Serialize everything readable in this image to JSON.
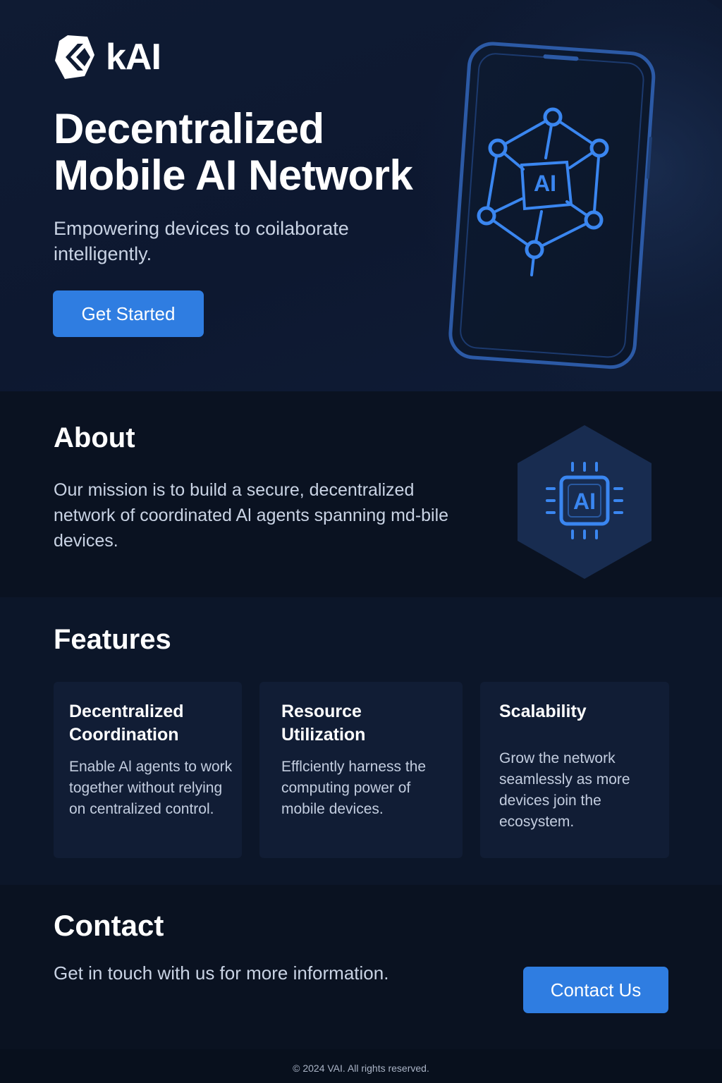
{
  "brand": {
    "name": "kAI",
    "logo_icon": "hexagon-k-logo-icon"
  },
  "hero": {
    "title_line1": "Decentralized",
    "title_line2": "Mobile AI Network",
    "subtitle": "Empowering devices to coilaborate intelligently.",
    "cta_label": "Get Started",
    "illustration_label": "AI",
    "illustration_icon": "smartphone-ai-network-icon"
  },
  "about": {
    "title": "About",
    "text": "Our mission is to build a secure, decentralized network of coordinated Al agents spanning md-bile devices.",
    "icon_label": "AI",
    "icon": "ai-chip-hexagon-icon"
  },
  "features": {
    "title": "Features",
    "cards": [
      {
        "title": "Decentralized Coordination",
        "text": "Enable Al agents to work together without relying on centralized control."
      },
      {
        "title": "Resource Utilization",
        "text": "Efflciently harness the computing power of mobile devices."
      },
      {
        "title": "Scalability",
        "text": "Grow the network seamlessly as more devices join the ecosystem."
      }
    ]
  },
  "contact": {
    "title": "Contact",
    "text": "Get in touch with us for more information.",
    "cta_label": "Contact Us"
  },
  "footer": {
    "text": "© 2024  VAI. All rights reserved."
  },
  "colors": {
    "background": "#0b1424",
    "accent": "#2f7de1",
    "icon_blue": "#3a86f0",
    "card": "#111d35"
  }
}
